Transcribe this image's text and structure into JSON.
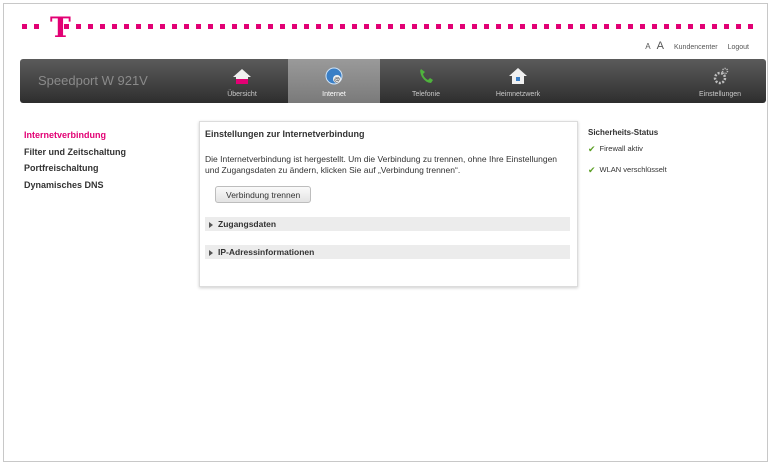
{
  "brand": {
    "logo_letter": "T",
    "accent": "#e20074"
  },
  "top_links": {
    "font_small": "A",
    "font_large": "A",
    "kundencenter": "Kundencenter",
    "logout": "Logout"
  },
  "nav": {
    "title": "Speedport W 921V",
    "tabs": [
      {
        "label": "Übersicht",
        "icon": "home-icon"
      },
      {
        "label": "Internet",
        "icon": "globe-icon",
        "active": true
      },
      {
        "label": "Telefonie",
        "icon": "phone-icon"
      },
      {
        "label": "Heimnetzwerk",
        "icon": "network-home-icon"
      },
      {
        "label": "Einstellungen",
        "icon": "gear-icon"
      }
    ]
  },
  "sidebar": {
    "items": [
      {
        "label": "Internetverbindung",
        "active": true
      },
      {
        "label": "Filter und Zeitschaltung"
      },
      {
        "label": "Portfreischaltung"
      },
      {
        "label": "Dynamisches DNS"
      }
    ]
  },
  "main": {
    "title": "Einstellungen zur Internetverbindung",
    "text": "Die Internetverbindung ist hergestellt. Um die Verbindung zu trennen, ohne Ihre Einstellungen und Zugangsdaten zu ändern, klicken Sie auf „Verbindung trennen“.",
    "button_label": "Verbindung trennen",
    "sections": [
      "Zugangsdaten",
      "IP-Adressinformationen"
    ]
  },
  "status": {
    "title": "Sicherheits-Status",
    "items": [
      "Firewall aktiv",
      "WLAN verschlüsselt"
    ],
    "ok_color": "#5a9e23"
  }
}
